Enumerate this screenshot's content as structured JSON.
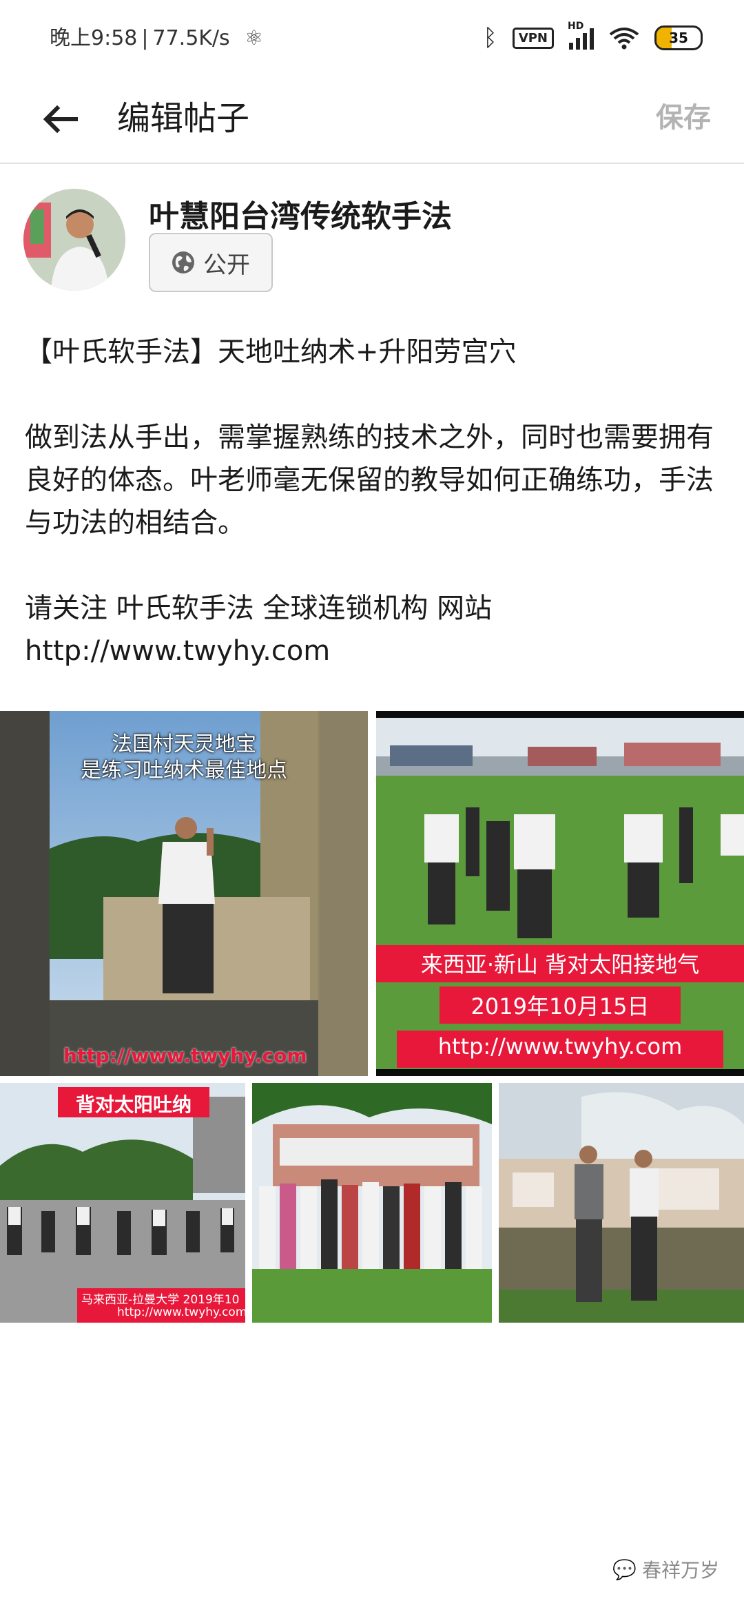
{
  "status_bar": {
    "time": "晚上9:58",
    "network_speed": "77.5K/s",
    "vpn_label": "VPN",
    "signal_label": "HD",
    "battery_level": "35",
    "icons": [
      "atom-icon",
      "bluetooth-icon",
      "vpn-icon",
      "signal-icon",
      "wifi-icon",
      "battery-icon"
    ]
  },
  "app_bar": {
    "title": "编辑帖子",
    "save_label": "保存",
    "back_icon": "arrow-left-icon"
  },
  "post": {
    "author": "叶慧阳台湾传统软手法",
    "privacy_label": "公开",
    "privacy_icon": "globe-icon",
    "paragraphs": [
      "【叶氏软手法】天地吐纳术+升阳劳宫穴",
      "做到法从手出，需掌握熟练的技术之外，同时也需要拥有良好的体态。叶老师毫无保留的教导如何正确练功，手法与功法的相结合。",
      "请关注 叶氏软手法 全球连锁机构 网站\nhttp://www.twyhy.com"
    ]
  },
  "images": [
    {
      "caption_lines": [
        "法国村天灵地宝",
        "是练习吐纳术最佳地点"
      ],
      "url_text": "http://www.twyhy.com"
    },
    {
      "caption": "来西亚·新山    背对太阳接地气",
      "date": "2019年10月15日",
      "url_text": "http://www.twyhy.com"
    },
    {
      "caption": "背对太阳吐纳",
      "footer": "马来西亚-拉曼大学    2019年10",
      "url_text": "http://www.twyhy.com"
    },
    {},
    {}
  ],
  "watermark": "春祥万岁",
  "colors": {
    "accent_red": "#e8183a",
    "save_disabled": "#b3b3b3",
    "battery": "#f0b400"
  }
}
